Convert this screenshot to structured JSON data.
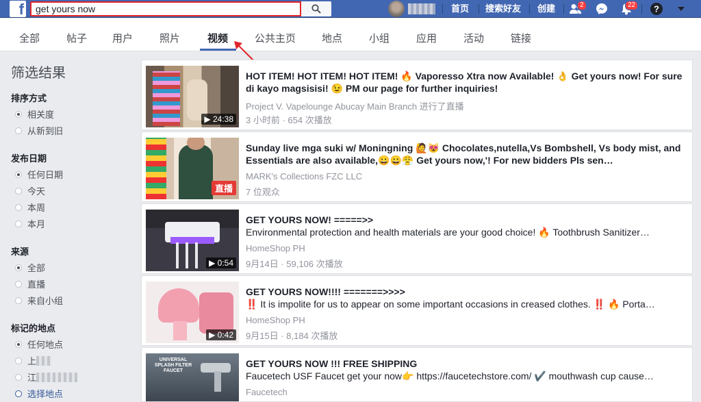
{
  "topbar": {
    "logo": "f",
    "search_value": "get yours now",
    "nav": [
      "首页",
      "搜索好友",
      "创建"
    ],
    "friend_badge": "2",
    "notif_badge": "22"
  },
  "tabs": [
    "全部",
    "帖子",
    "用户",
    "照片",
    "视频",
    "公共主页",
    "地点",
    "小组",
    "应用",
    "活动",
    "链接"
  ],
  "sidebar": {
    "title": "筛选结果",
    "sections": [
      {
        "heading": "排序方式",
        "options": [
          "相关度",
          "从新到旧"
        ]
      },
      {
        "heading": "发布日期",
        "options": [
          "任何日期",
          "今天",
          "本周",
          "本月"
        ]
      },
      {
        "heading": "来源",
        "options": [
          "全部",
          "直播",
          "来自小组"
        ]
      },
      {
        "heading": "标记的地点",
        "options": [
          "任何地点",
          "上",
          "江",
          "选择地点"
        ]
      }
    ]
  },
  "results": [
    {
      "title": "HOT ITEM! HOT ITEM! HOT ITEM! 🔥 Vaporesso Xtra now Available! 👌 Get yours now! For sure di kayo magsisisi! 😉 PM our page for further inquiries!",
      "desc": "",
      "source": "Project V. Vapelounge Abucay Main Branch 进行了直播",
      "meta": "3 小时前 · 654 次播放",
      "duration": "▶ 24:38"
    },
    {
      "title": "Sunday live mga suki w/ Moningning 🙋😻 Chocolates,nutella,Vs Bombshell, Vs body mist, and Essentials are also available,😀😀😤 Get yours now,'! For new bidders Pls sen…",
      "desc": "",
      "source": "MARK's Collections FZC LLC",
      "meta": "7 位观众",
      "duration": "直播"
    },
    {
      "title": "GET YOURS NOW! =====>>",
      "desc": "Environmental protection and health materials are your good choice! 🔥 Toothbrush Sanitizer…",
      "source": "HomeShop PH",
      "meta": "9月14日 · 59,106 次播放",
      "duration": "▶ 0:54"
    },
    {
      "title": "GET YOURS NOW!!!! =======>>>>",
      "desc": "‼️ It is impolite for us to appear on some important occasions in creased clothes. ‼️ 🔥 Porta…",
      "source": "HomeShop PH",
      "meta": "9月15日 · 8,184 次播放",
      "duration": "▶ 0:42"
    },
    {
      "title": "GET YOURS NOW !!! FREE SHIPPING",
      "desc": "Faucetech USF Faucet get your now👉 https://faucetechstore.com/ ✔️ mouthwash cup cause…",
      "source": "Faucetech",
      "meta": "",
      "duration": "",
      "thumb_text": "UNIVERSAL SPLASH FILTER FAUCET"
    }
  ]
}
